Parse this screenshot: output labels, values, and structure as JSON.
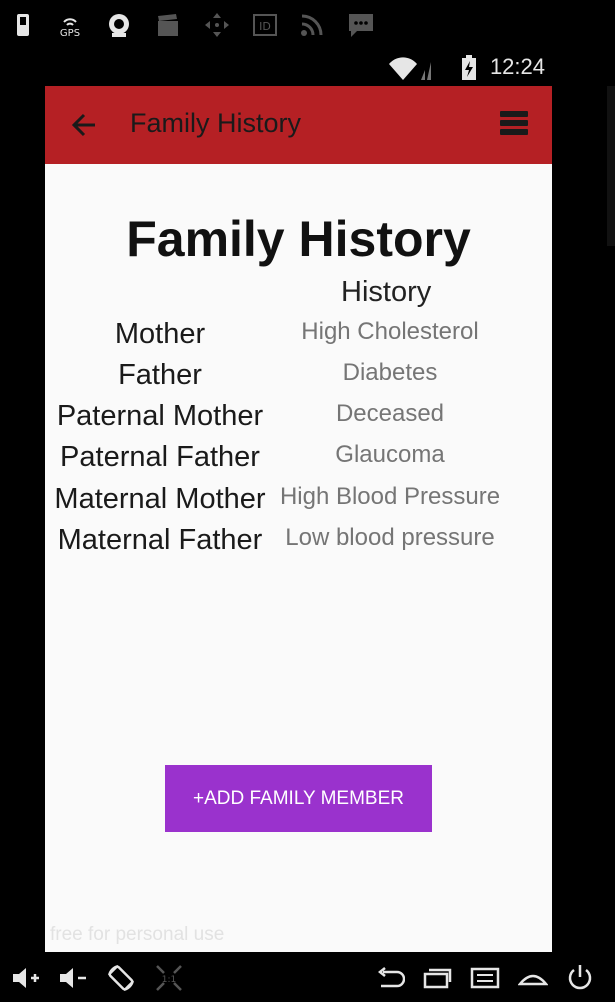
{
  "status": {
    "time": "12:24"
  },
  "notifications": [
    {
      "icon": "sim-icon"
    },
    {
      "icon": "gps-icon"
    },
    {
      "icon": "camera-icon"
    },
    {
      "icon": "clapper-icon"
    },
    {
      "icon": "move-icon"
    },
    {
      "icon": "id-icon"
    },
    {
      "icon": "rss-icon"
    },
    {
      "icon": "sms-icon"
    }
  ],
  "toolbar": {
    "title": "Family History"
  },
  "page": {
    "title": "Family History",
    "column_header": "History",
    "rows": [
      {
        "relation": "Mother",
        "condition": "High Cholesterol"
      },
      {
        "relation": "Father",
        "condition": "Diabetes"
      },
      {
        "relation": "Paternal Mother",
        "condition": "Deceased"
      },
      {
        "relation": "Paternal Father",
        "condition": "Glaucoma"
      },
      {
        "relation": "Maternal Mother",
        "condition": "High Blood Pressure"
      },
      {
        "relation": "Maternal Father",
        "condition": "Low blood pressure"
      }
    ],
    "add_button": "+ADD FAMILY MEMBER",
    "watermark": "free for personal use"
  },
  "colors": {
    "toolbar": "#b52024",
    "button": "#9a32cd",
    "background": "#fafafa"
  }
}
